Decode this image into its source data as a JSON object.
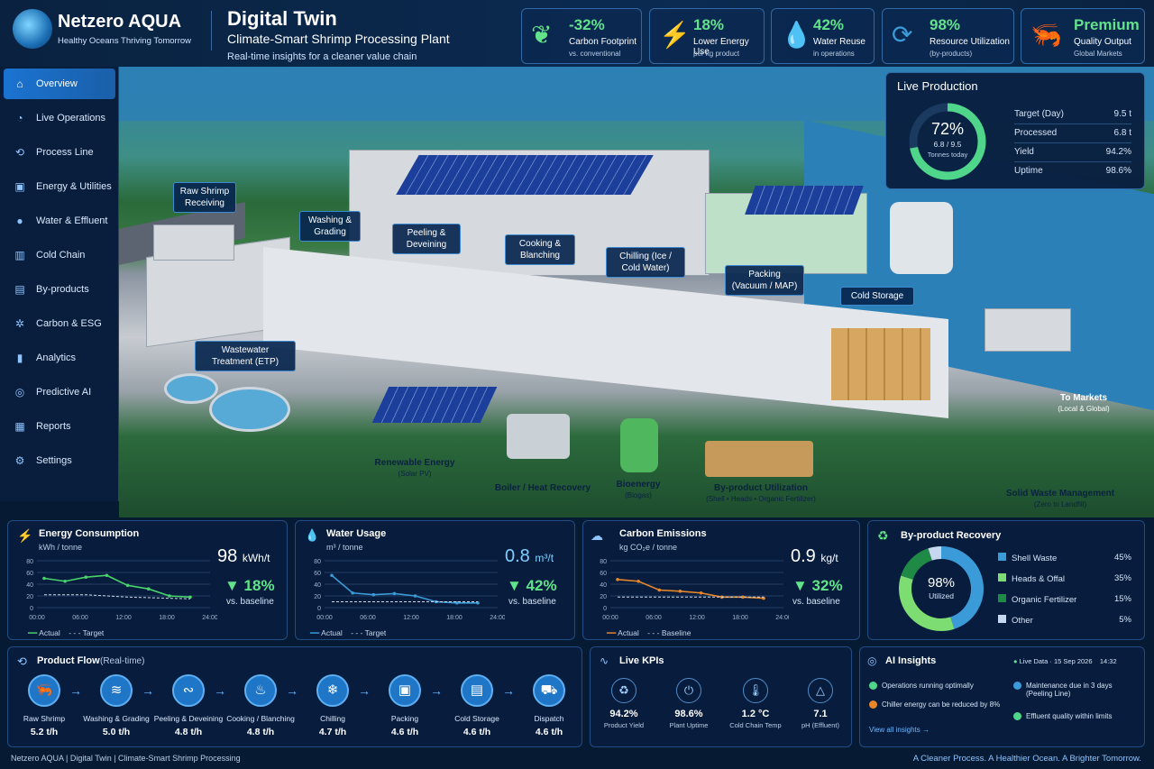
{
  "brand": {
    "name": "Netzero AQUA",
    "tagline": "Healthy Oceans  Thriving Tomorrow"
  },
  "title": {
    "main": "Digital Twin",
    "sub": "Climate-Smart Shrimp Processing Plant",
    "desc": "Real-time insights for a cleaner value chain"
  },
  "kpis": [
    {
      "value": "-32%",
      "label": "Carbon Footprint",
      "sub": "vs. conventional",
      "icon": "leaf-icon"
    },
    {
      "value": "18%",
      "label": "Lower Energy Use",
      "sub": "per kg product",
      "icon": "lightning-icon"
    },
    {
      "value": "42%",
      "label": "Water Reuse",
      "sub": "in operations",
      "icon": "water-drop-icon"
    },
    {
      "value": "98%",
      "label": "Resource Utilization",
      "sub": "(by-products)",
      "icon": "recycle-icon"
    },
    {
      "value": "Premium",
      "label": "Quality Output",
      "sub": "Global Markets",
      "icon": "shrimp-icon"
    }
  ],
  "nav": [
    {
      "label": "Overview",
      "icon": "home-icon"
    },
    {
      "label": "Live Operations",
      "icon": "gauge-icon"
    },
    {
      "label": "Process Line",
      "icon": "process-icon"
    },
    {
      "label": "Energy & Utilities",
      "icon": "energy-icon"
    },
    {
      "label": "Water & Effluent",
      "icon": "water-icon"
    },
    {
      "label": "Cold Chain",
      "icon": "cold-chain-icon"
    },
    {
      "label": "By-products",
      "icon": "byproducts-icon"
    },
    {
      "label": "Carbon & ESG",
      "icon": "carbon-icon"
    },
    {
      "label": "Analytics",
      "icon": "analytics-icon"
    },
    {
      "label": "Predictive AI",
      "icon": "ai-icon"
    },
    {
      "label": "Reports",
      "icon": "reports-icon"
    },
    {
      "label": "Settings",
      "icon": "gear-icon"
    }
  ],
  "scene": {
    "raw": "Raw Shrimp Receiving",
    "wash": "Washing & Grading",
    "peel": "Peeling & Deveining",
    "cook": "Cooking & Blanching",
    "chill": "Chilling (Ice / Cold Water)",
    "pack": "Packing (Vacuum / MAP)",
    "cold": "Cold Storage",
    "etp": "Wastewater Treatment (ETP)",
    "solar": "Renewable Energy",
    "solar_sub": "(Solar PV)",
    "boiler": "Boiler / Heat Recovery",
    "bio": "Bioenergy",
    "bio_sub": "(Biogas)",
    "byp": "By-product Utilization",
    "byp_sub": "(Shell • Heads • Organic Fertilizer)",
    "solid": "Solid Waste Management",
    "solid_sub": "(Zero to Landfill)",
    "markets": "To Markets",
    "markets_sub": "(Local & Global)"
  },
  "live_production": {
    "title": "Live Production",
    "pct": "72%",
    "sub1": "6.8 / 9.5",
    "sub2": "Tonnes today",
    "progress": 0.72,
    "rows": [
      {
        "k": "Target (Day)",
        "v": "9.5 t"
      },
      {
        "k": "Processed",
        "v": "6.8 t"
      },
      {
        "k": "Yield",
        "v": "94.2%"
      },
      {
        "k": "Uptime",
        "v": "98.6%"
      }
    ]
  },
  "energy": {
    "title": "Energy Consumption",
    "unit": "kWh / tonne",
    "value": "98",
    "vunit": "kWh/t",
    "change": "▼ 18%",
    "vs": "vs. baseline",
    "legend_a": "Actual",
    "legend_b": "Target"
  },
  "water": {
    "title": "Water Usage",
    "unit": "m³ / tonne",
    "value": "0.8",
    "vunit": "m³/t",
    "change": "▼ 42%",
    "vs": "vs. baseline",
    "legend_a": "Actual",
    "legend_b": "Target"
  },
  "carbon": {
    "title": "Carbon Emissions",
    "unit": "kg CO₂e / tonne",
    "value": "0.9",
    "vunit": "kg/t",
    "change": "▼ 32%",
    "vs": "vs. baseline",
    "legend_a": "Actual",
    "legend_b": "Baseline"
  },
  "chart_data": [
    {
      "type": "line",
      "title": "Energy Consumption",
      "x": [
        "00:00",
        "03:00",
        "06:00",
        "09:00",
        "12:00",
        "15:00",
        "18:00",
        "21:00"
      ],
      "xticks": [
        "00:00",
        "06:00",
        "12:00",
        "18:00",
        "24:00"
      ],
      "yticks": [
        "0",
        "20",
        "40",
        "60",
        "80"
      ],
      "ylim": [
        0,
        80
      ],
      "series": [
        {
          "name": "Actual",
          "values": [
            50,
            45,
            52,
            55,
            38,
            32,
            20,
            18
          ]
        },
        {
          "name": "Target",
          "values": [
            22,
            22,
            22,
            20,
            18,
            17,
            16,
            15
          ]
        }
      ]
    },
    {
      "type": "line",
      "title": "Water Usage",
      "x": [
        "00:00",
        "03:00",
        "06:00",
        "09:00",
        "12:00",
        "15:00",
        "18:00",
        "21:00"
      ],
      "xticks": [
        "00:00",
        "06:00",
        "12:00",
        "18:00",
        "24:00"
      ],
      "yticks": [
        "0",
        "20",
        "40",
        "60",
        "80"
      ],
      "ylim": [
        0,
        80
      ],
      "series": [
        {
          "name": "Actual",
          "values": [
            55,
            25,
            22,
            24,
            20,
            10,
            8,
            8
          ]
        },
        {
          "name": "Target",
          "values": [
            10,
            10,
            10,
            10,
            10,
            10,
            10,
            10
          ]
        }
      ]
    },
    {
      "type": "line",
      "title": "Carbon Emissions",
      "x": [
        "00:00",
        "03:00",
        "06:00",
        "09:00",
        "12:00",
        "15:00",
        "18:00",
        "21:00"
      ],
      "xticks": [
        "00:00",
        "06:00",
        "12:00",
        "18:00",
        "24:00"
      ],
      "yticks": [
        "0",
        "20",
        "40",
        "60",
        "80"
      ],
      "ylim": [
        0,
        80
      ],
      "series": [
        {
          "name": "Actual",
          "values": [
            48,
            45,
            30,
            28,
            25,
            18,
            18,
            16
          ]
        },
        {
          "name": "Baseline",
          "values": [
            18,
            18,
            18,
            18,
            18,
            18,
            18,
            18
          ]
        }
      ]
    },
    {
      "type": "pie",
      "title": "By-product Recovery",
      "center": "98%",
      "center_sub": "Utilized",
      "series": [
        {
          "name": "Shell Waste",
          "values": [
            45
          ],
          "color": "#3b9bd8"
        },
        {
          "name": "Heads & Offal",
          "values": [
            35
          ],
          "color": "#7ddc72"
        },
        {
          "name": "Organic Fertilizer",
          "values": [
            15
          ],
          "color": "#1e8a45"
        },
        {
          "name": "Other",
          "values": [
            5
          ],
          "color": "#c6d8ef"
        }
      ]
    }
  ],
  "byproduct": {
    "title": "By-product Recovery",
    "center": "98%",
    "center_sub": "Utilized",
    "items": [
      {
        "k": "Shell Waste",
        "v": "45%"
      },
      {
        "k": "Heads & Offal",
        "v": "35%"
      },
      {
        "k": "Organic Fertilizer",
        "v": "15%"
      },
      {
        "k": "Other",
        "v": "5%"
      }
    ]
  },
  "product_flow": {
    "title": "Product Flow",
    "sub": "(Real-time)",
    "steps": [
      {
        "n": "Raw Shrimp",
        "r": "5.2 t/h",
        "icon": "shrimp-icon"
      },
      {
        "n": "Washing & Grading",
        "r": "5.0 t/h",
        "icon": "wash-icon"
      },
      {
        "n": "Peeling & Deveining",
        "r": "4.8 t/h",
        "icon": "peel-icon"
      },
      {
        "n": "Cooking / Blanching",
        "r": "4.8 t/h",
        "icon": "cook-icon"
      },
      {
        "n": "Chilling",
        "r": "4.7 t/h",
        "icon": "snowflake-icon"
      },
      {
        "n": "Packing",
        "r": "4.6 t/h",
        "icon": "box-icon"
      },
      {
        "n": "Cold Storage",
        "r": "4.6 t/h",
        "icon": "storage-icon"
      },
      {
        "n": "Dispatch",
        "r": "4.6 t/h",
        "icon": "truck-icon"
      }
    ]
  },
  "live_kpis": {
    "title": "Live KPIs",
    "items": [
      {
        "v": "94.2%",
        "l": "Product Yield",
        "icon": "recycle-icon"
      },
      {
        "v": "98.6%",
        "l": "Plant Uptime",
        "icon": "power-icon"
      },
      {
        "v": "1.2 °C",
        "l": "Cold Chain Temp",
        "icon": "thermometer-icon"
      },
      {
        "v": "7.1",
        "l": "pH (Effluent)",
        "icon": "ph-icon"
      }
    ]
  },
  "ai": {
    "title": "AI Insights",
    "live": "Live Data",
    "date": "15 Sep 2026",
    "time": "14:32",
    "i1": "Operations running optimally",
    "i2": "Chiller energy can be reduced by 8%",
    "i3": "Maintenance due in 3 days",
    "i3b": "(Peeling Line)",
    "i4": "Effluent quality within limits",
    "link": "View all insights →"
  },
  "footer": {
    "left": "Netzero AQUA  |  Digital Twin  |  Climate-Smart Shrimp Processing",
    "right": "A Cleaner Process. A Healthier Ocean. A Brighter Tomorrow."
  },
  "colors": {
    "accent": "#1f76c7",
    "green": "#62e38b",
    "energy": "#49d36b",
    "water": "#3b9bd8",
    "carbon": "#e8872a"
  }
}
